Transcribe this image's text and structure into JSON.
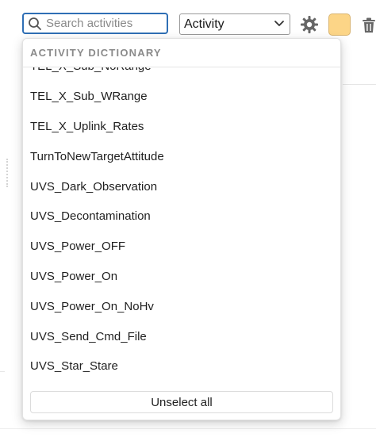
{
  "toolbar": {
    "search": {
      "placeholder": "Search activities",
      "value": "",
      "icon": "search-icon"
    },
    "type_select": {
      "selected": "Activity",
      "icon": "chevron-down-icon"
    },
    "settings_icon": "gear-icon",
    "color_swatch": {
      "color": "#fcd587"
    },
    "delete_icon": "trash-icon"
  },
  "dropdown": {
    "header": "ACTIVITY DICTIONARY",
    "items": [
      "TEL_X_Sub_NoRange",
      "TEL_X_Sub_WRange",
      "TEL_X_Uplink_Rates",
      "TurnToNewTargetAttitude",
      "UVS_Dark_Observation",
      "UVS_Decontamination",
      "UVS_Power_OFF",
      "UVS_Power_On",
      "UVS_Power_On_NoHv",
      "UVS_Send_Cmd_File",
      "UVS_Star_Stare"
    ],
    "unselect_label": "Unselect all"
  },
  "colors": {
    "accent": "#2f6fb5",
    "swatch": "#fcd587"
  }
}
